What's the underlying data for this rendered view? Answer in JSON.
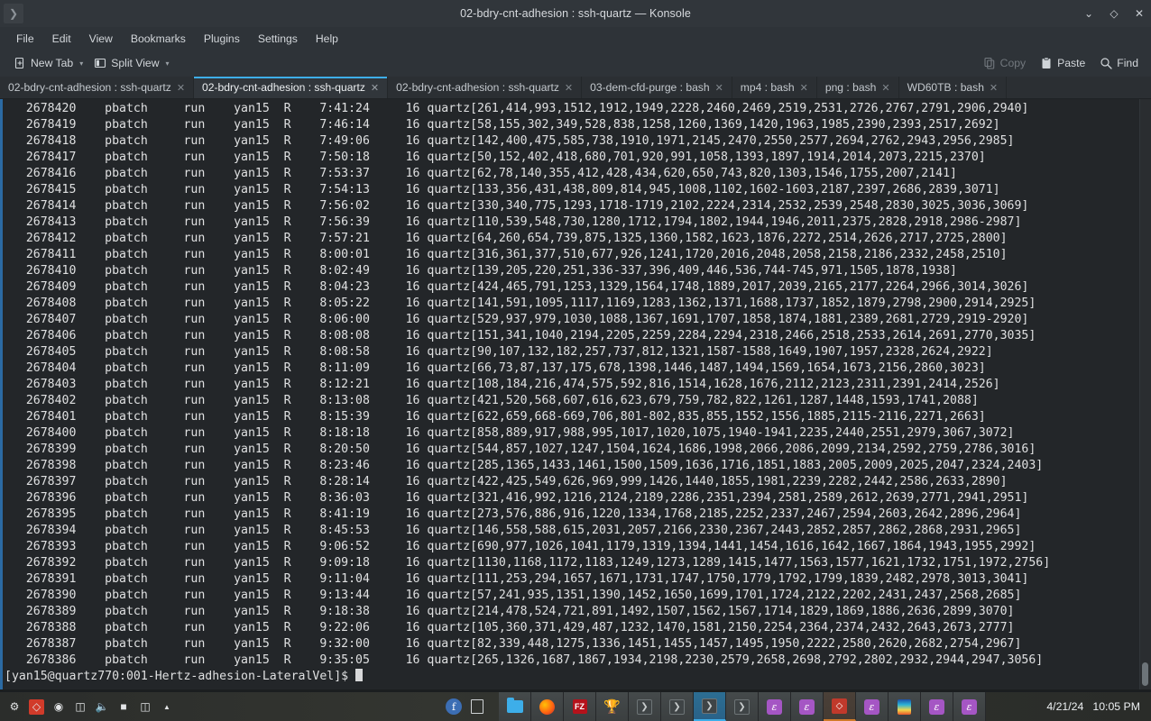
{
  "window": {
    "title": "02-bdry-cnt-adhesion : ssh-quartz — Konsole",
    "menu_button_icon": "chevron-right-icon",
    "controls": {
      "minimize": "⌄",
      "maximize": "◇",
      "close": "✕"
    }
  },
  "menubar": {
    "items": [
      {
        "label": "File"
      },
      {
        "label": "Edit"
      },
      {
        "label": "View"
      },
      {
        "label": "Bookmarks"
      },
      {
        "label": "Plugins"
      },
      {
        "label": "Settings"
      },
      {
        "label": "Help"
      }
    ]
  },
  "toolbar": {
    "new_tab_label": "New Tab",
    "new_tab_icon": "new-tab-icon",
    "split_view_label": "Split View",
    "split_view_icon": "split-view-icon",
    "copy_label": "Copy",
    "copy_icon": "copy-icon",
    "paste_label": "Paste",
    "paste_icon": "paste-icon",
    "find_label": "Find",
    "find_icon": "search-icon"
  },
  "tabs": [
    {
      "label": "02-bdry-cnt-adhesion : ssh-quartz",
      "active": false,
      "close": "✕"
    },
    {
      "label": "02-bdry-cnt-adhesion : ssh-quartz",
      "active": true,
      "close": "✕"
    },
    {
      "label": "02-bdry-cnt-adhesion : ssh-quartz",
      "active": false,
      "close": "✕"
    },
    {
      "label": "03-dem-cfd-purge : bash",
      "active": false,
      "close": "✕"
    },
    {
      "label": "mp4 : bash",
      "active": false,
      "close": "✕"
    },
    {
      "label": "png : bash",
      "active": false,
      "close": "✕"
    },
    {
      "label": "WD60TB : bash",
      "active": false,
      "close": "✕"
    }
  ],
  "terminal": {
    "colors": {
      "background": "#232629",
      "foreground": "#dfe0e1",
      "accent": "#3daee9"
    },
    "prompt": "[yan15@quartz770:001-Hertz-adhesion-LateralVel]$ ",
    "lines": [
      "   2678420    pbatch     run    yan15  R    7:41:24     16 quartz[261,414,993,1512,1912,1949,2228,2460,2469,2519,2531,2726,2767,2791,2906,2940]",
      "   2678419    pbatch     run    yan15  R    7:46:14     16 quartz[58,155,302,349,528,838,1258,1260,1369,1420,1963,1985,2390,2393,2517,2692]",
      "   2678418    pbatch     run    yan15  R    7:49:06     16 quartz[142,400,475,585,738,1910,1971,2145,2470,2550,2577,2694,2762,2943,2956,2985]",
      "   2678417    pbatch     run    yan15  R    7:50:18     16 quartz[50,152,402,418,680,701,920,991,1058,1393,1897,1914,2014,2073,2215,2370]",
      "   2678416    pbatch     run    yan15  R    7:53:37     16 quartz[62,78,140,355,412,428,434,620,650,743,820,1303,1546,1755,2007,2141]",
      "   2678415    pbatch     run    yan15  R    7:54:13     16 quartz[133,356,431,438,809,814,945,1008,1102,1602-1603,2187,2397,2686,2839,3071]",
      "   2678414    pbatch     run    yan15  R    7:56:02     16 quartz[330,340,775,1293,1718-1719,2102,2224,2314,2532,2539,2548,2830,3025,3036,3069]",
      "   2678413    pbatch     run    yan15  R    7:56:39     16 quartz[110,539,548,730,1280,1712,1794,1802,1944,1946,2011,2375,2828,2918,2986-2987]",
      "   2678412    pbatch     run    yan15  R    7:57:21     16 quartz[64,260,654,739,875,1325,1360,1582,1623,1876,2272,2514,2626,2717,2725,2800]",
      "   2678411    pbatch     run    yan15  R    8:00:01     16 quartz[316,361,377,510,677,926,1241,1720,2016,2048,2058,2158,2186,2332,2458,2510]",
      "   2678410    pbatch     run    yan15  R    8:02:49     16 quartz[139,205,220,251,336-337,396,409,446,536,744-745,971,1505,1878,1938]",
      "   2678409    pbatch     run    yan15  R    8:04:23     16 quartz[424,465,791,1253,1329,1564,1748,1889,2017,2039,2165,2177,2264,2966,3014,3026]",
      "   2678408    pbatch     run    yan15  R    8:05:22     16 quartz[141,591,1095,1117,1169,1283,1362,1371,1688,1737,1852,1879,2798,2900,2914,2925]",
      "   2678407    pbatch     run    yan15  R    8:06:00     16 quartz[529,937,979,1030,1088,1367,1691,1707,1858,1874,1881,2389,2681,2729,2919-2920]",
      "   2678406    pbatch     run    yan15  R    8:08:08     16 quartz[151,341,1040,2194,2205,2259,2284,2294,2318,2466,2518,2533,2614,2691,2770,3035]",
      "   2678405    pbatch     run    yan15  R    8:08:58     16 quartz[90,107,132,182,257,737,812,1321,1587-1588,1649,1907,1957,2328,2624,2922]",
      "   2678404    pbatch     run    yan15  R    8:11:09     16 quartz[66,73,87,137,175,678,1398,1446,1487,1494,1569,1654,1673,2156,2860,3023]",
      "   2678403    pbatch     run    yan15  R    8:12:21     16 quartz[108,184,216,474,575,592,816,1514,1628,1676,2112,2123,2311,2391,2414,2526]",
      "   2678402    pbatch     run    yan15  R    8:13:08     16 quartz[421,520,568,607,616,623,679,759,782,822,1261,1287,1448,1593,1741,2088]",
      "   2678401    pbatch     run    yan15  R    8:15:39     16 quartz[622,659,668-669,706,801-802,835,855,1552,1556,1885,2115-2116,2271,2663]",
      "   2678400    pbatch     run    yan15  R    8:18:18     16 quartz[858,889,917,988,995,1017,1020,1075,1940-1941,2235,2440,2551,2979,3067,3072]",
      "   2678399    pbatch     run    yan15  R    8:20:50     16 quartz[544,857,1027,1247,1504,1624,1686,1998,2066,2086,2099,2134,2592,2759,2786,3016]",
      "   2678398    pbatch     run    yan15  R    8:23:46     16 quartz[285,1365,1433,1461,1500,1509,1636,1716,1851,1883,2005,2009,2025,2047,2324,2403]",
      "   2678397    pbatch     run    yan15  R    8:28:14     16 quartz[422,425,549,626,969,999,1426,1440,1855,1981,2239,2282,2442,2586,2633,2890]",
      "   2678396    pbatch     run    yan15  R    8:36:03     16 quartz[321,416,992,1216,2124,2189,2286,2351,2394,2581,2589,2612,2639,2771,2941,2951]",
      "   2678395    pbatch     run    yan15  R    8:41:19     16 quartz[273,576,886,916,1220,1334,1768,2185,2252,2337,2467,2594,2603,2642,2896,2964]",
      "   2678394    pbatch     run    yan15  R    8:45:53     16 quartz[146,558,588,615,2031,2057,2166,2330,2367,2443,2852,2857,2862,2868,2931,2965]",
      "   2678393    pbatch     run    yan15  R    9:06:52     16 quartz[690,977,1026,1041,1179,1319,1394,1441,1454,1616,1642,1667,1864,1943,1955,2992]",
      "   2678392    pbatch     run    yan15  R    9:09:18     16 quartz[1130,1168,1172,1183,1249,1273,1289,1415,1477,1563,1577,1621,1732,1751,1972,2756]",
      "   2678391    pbatch     run    yan15  R    9:11:04     16 quartz[111,253,294,1657,1671,1731,1747,1750,1779,1792,1799,1839,2482,2978,3013,3041]",
      "   2678390    pbatch     run    yan15  R    9:13:44     16 quartz[57,241,935,1351,1390,1452,1650,1699,1701,1724,2122,2202,2431,2437,2568,2685]",
      "   2678389    pbatch     run    yan15  R    9:18:38     16 quartz[214,478,524,721,891,1492,1507,1562,1567,1714,1829,1869,1886,2636,2899,3070]",
      "   2678388    pbatch     run    yan15  R    9:22:06     16 quartz[105,360,371,429,487,1232,1470,1581,2150,2254,2364,2374,2432,2643,2673,2777]",
      "   2678387    pbatch     run    yan15  R    9:32:00     16 quartz[82,339,448,1275,1336,1451,1455,1457,1495,1950,2222,2580,2620,2682,2754,2967]",
      "   2678386    pbatch     run    yan15  R    9:35:05     16 quartz[265,1326,1687,1867,1934,2198,2230,2579,2658,2698,2792,2802,2932,2944,2947,3056]"
    ]
  },
  "taskbar": {
    "tray_icons": [
      "bell-icon",
      "red-diamond-icon",
      "notification-icon",
      "clipboard-icon",
      "volume-icon",
      "battery-icon",
      "display-icon",
      "show-hidden-icon"
    ],
    "launcher_icons": [
      "fedora-icon",
      "book-icon"
    ],
    "window_buttons": [
      {
        "icon": "folder-icon",
        "state": "normal"
      },
      {
        "icon": "firefox-icon",
        "state": "normal"
      },
      {
        "icon": "filezilla-icon",
        "state": "normal"
      },
      {
        "icon": "gold-trophy-icon",
        "state": "normal"
      },
      {
        "icon": "konsole-icon",
        "state": "normal"
      },
      {
        "icon": "konsole-icon",
        "state": "normal"
      },
      {
        "icon": "konsole-icon",
        "state": "selected"
      },
      {
        "icon": "konsole-icon",
        "state": "normal"
      },
      {
        "icon": "konsole-icon",
        "state": "normal"
      },
      {
        "icon": "epsilon-icon",
        "state": "normal"
      },
      {
        "icon": "epsilon-icon",
        "state": "normal"
      },
      {
        "icon": "red-diamond-icon",
        "state": "attention"
      },
      {
        "icon": "epsilon-icon",
        "state": "normal"
      },
      {
        "icon": "flame-icon",
        "state": "normal"
      },
      {
        "icon": "epsilon-icon",
        "state": "normal"
      },
      {
        "icon": "epsilon-icon",
        "state": "normal"
      }
    ],
    "date": "4/21/24",
    "time": "10:05 PM"
  }
}
